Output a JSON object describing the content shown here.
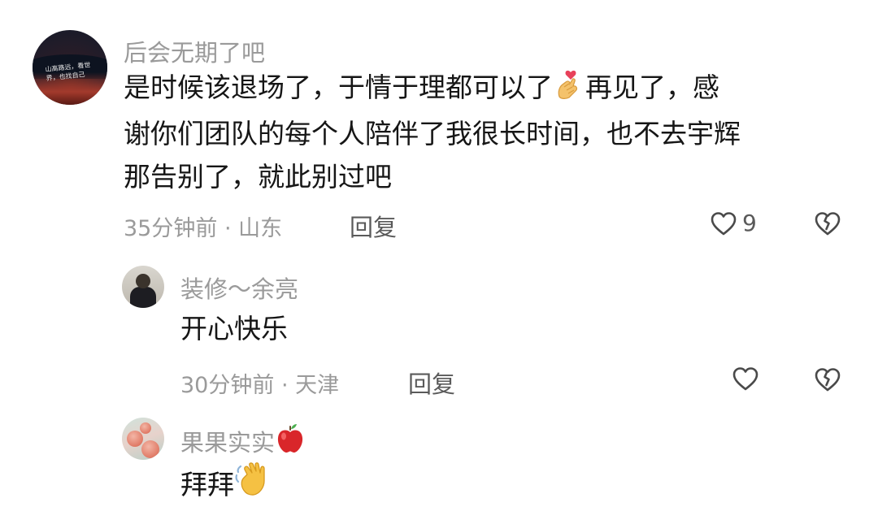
{
  "comments": [
    {
      "username": "后会无期了吧",
      "text_line1": "是时候该退场了，于情于理都可以了",
      "text_line1b": "再见了，感",
      "text_line2": "谢你们团队的每个人陪伴了我很长时间，也不去宇辉",
      "text_line3": "那告别了，就此别过吧",
      "inline_emoji": "finger-heart-emoji",
      "meta": "35分钟前 · 山东",
      "reply_label": "回复",
      "like_count": "9",
      "avatar_caption": "山高路远，看世界，也找自己"
    },
    {
      "username": "装修～余亮",
      "text": "开心快乐",
      "meta": "30分钟前 · 天津",
      "reply_label": "回复"
    },
    {
      "username": "果果实实",
      "username_emoji": "apple-emoji",
      "text": "拜拜",
      "text_emoji": "waving-hand-emoji"
    }
  ],
  "colors": {
    "username": "#9a9a9a",
    "text": "#161616",
    "meta": "#9a9a9a",
    "reply": "#5a5a5a"
  }
}
